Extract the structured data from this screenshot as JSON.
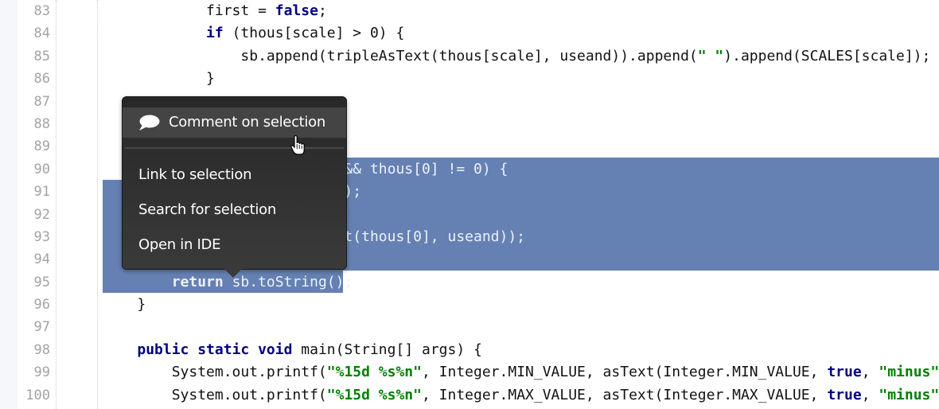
{
  "editor": {
    "line_numbers": [
      "83",
      "84",
      "85",
      "86",
      "87",
      "88",
      "89",
      "90",
      "91",
      "92",
      "93",
      "94",
      "95",
      "96",
      "97",
      "98",
      "99",
      "100"
    ],
    "lines": [
      {
        "selected": false,
        "segments": [
          {
            "t": "            first = ",
            "c": ""
          },
          {
            "t": "false",
            "c": "kw"
          },
          {
            "t": ";",
            "c": ""
          }
        ]
      },
      {
        "selected": false,
        "segments": [
          {
            "t": "            ",
            "c": ""
          },
          {
            "t": "if",
            "c": "kw"
          },
          {
            "t": " (thous[scale] > 0) {",
            "c": ""
          }
        ]
      },
      {
        "selected": false,
        "segments": [
          {
            "t": "                sb.append(tripleAsText(thous[scale], useand)).append(",
            "c": ""
          },
          {
            "t": "\" \"",
            "c": "str"
          },
          {
            "t": ").append(SCALES[scale]);",
            "c": ""
          }
        ]
      },
      {
        "selected": false,
        "segments": [
          {
            "t": "            }",
            "c": ""
          }
        ]
      },
      {
        "selected": false,
        "segments": []
      },
      {
        "selected": false,
        "segments": []
      },
      {
        "selected": false,
        "segments": []
      },
      {
        "selected": true,
        "segments": [
          {
            "t": "                            && thous[0] != 0) {",
            "c": ""
          }
        ]
      },
      {
        "selected": true,
        "segments": [
          {
            "t": "                            );",
            "c": ""
          }
        ]
      },
      {
        "selected": true,
        "segments": []
      },
      {
        "selected": true,
        "segments": [
          {
            "t": "                            t(thous[0], useand));",
            "c": ""
          }
        ]
      },
      {
        "selected": true,
        "segments": []
      },
      {
        "selected": true,
        "segments": [
          {
            "t": "        ",
            "c": ""
          },
          {
            "t": "return",
            "c": "kw"
          },
          {
            "t": " sb.toString();",
            "c": ""
          }
        ]
      },
      {
        "selected": false,
        "segments": [
          {
            "t": "    }",
            "c": ""
          }
        ]
      },
      {
        "selected": false,
        "segments": []
      },
      {
        "selected": false,
        "segments": [
          {
            "t": "    ",
            "c": ""
          },
          {
            "t": "public static void",
            "c": "kw"
          },
          {
            "t": " main(String[] args) {",
            "c": ""
          }
        ]
      },
      {
        "selected": false,
        "segments": [
          {
            "t": "        System.out.printf(",
            "c": ""
          },
          {
            "t": "\"%15d %s%n\"",
            "c": "str"
          },
          {
            "t": ", Integer.MIN_VALUE, asText(Integer.MIN_VALUE, ",
            "c": ""
          },
          {
            "t": "true",
            "c": "kw"
          },
          {
            "t": ", ",
            "c": ""
          },
          {
            "t": "\"minus\"",
            "c": "str"
          },
          {
            "t": "));",
            "c": ""
          }
        ]
      },
      {
        "selected": false,
        "segments": [
          {
            "t": "        System.out.printf(",
            "c": ""
          },
          {
            "t": "\"%15d %s%n\"",
            "c": "str"
          },
          {
            "t": ", Integer.MAX_VALUE, asText(Integer.MAX_VALUE, ",
            "c": ""
          },
          {
            "t": "true",
            "c": "kw"
          },
          {
            "t": ", ",
            "c": ""
          },
          {
            "t": "\"minus\"",
            "c": "str"
          },
          {
            "t": "));",
            "c": ""
          }
        ]
      }
    ],
    "selection_color": "#6581b3",
    "keyword_color": "#000080",
    "string_color": "#008000"
  },
  "context_menu": {
    "comment_icon": "speech-bubble-icon",
    "comment_label": "Comment on selection",
    "link_label": "Link to selection",
    "search_label": "Search for selection",
    "ide_label": "Open in IDE"
  },
  "cursor": "hand-pointer-icon"
}
